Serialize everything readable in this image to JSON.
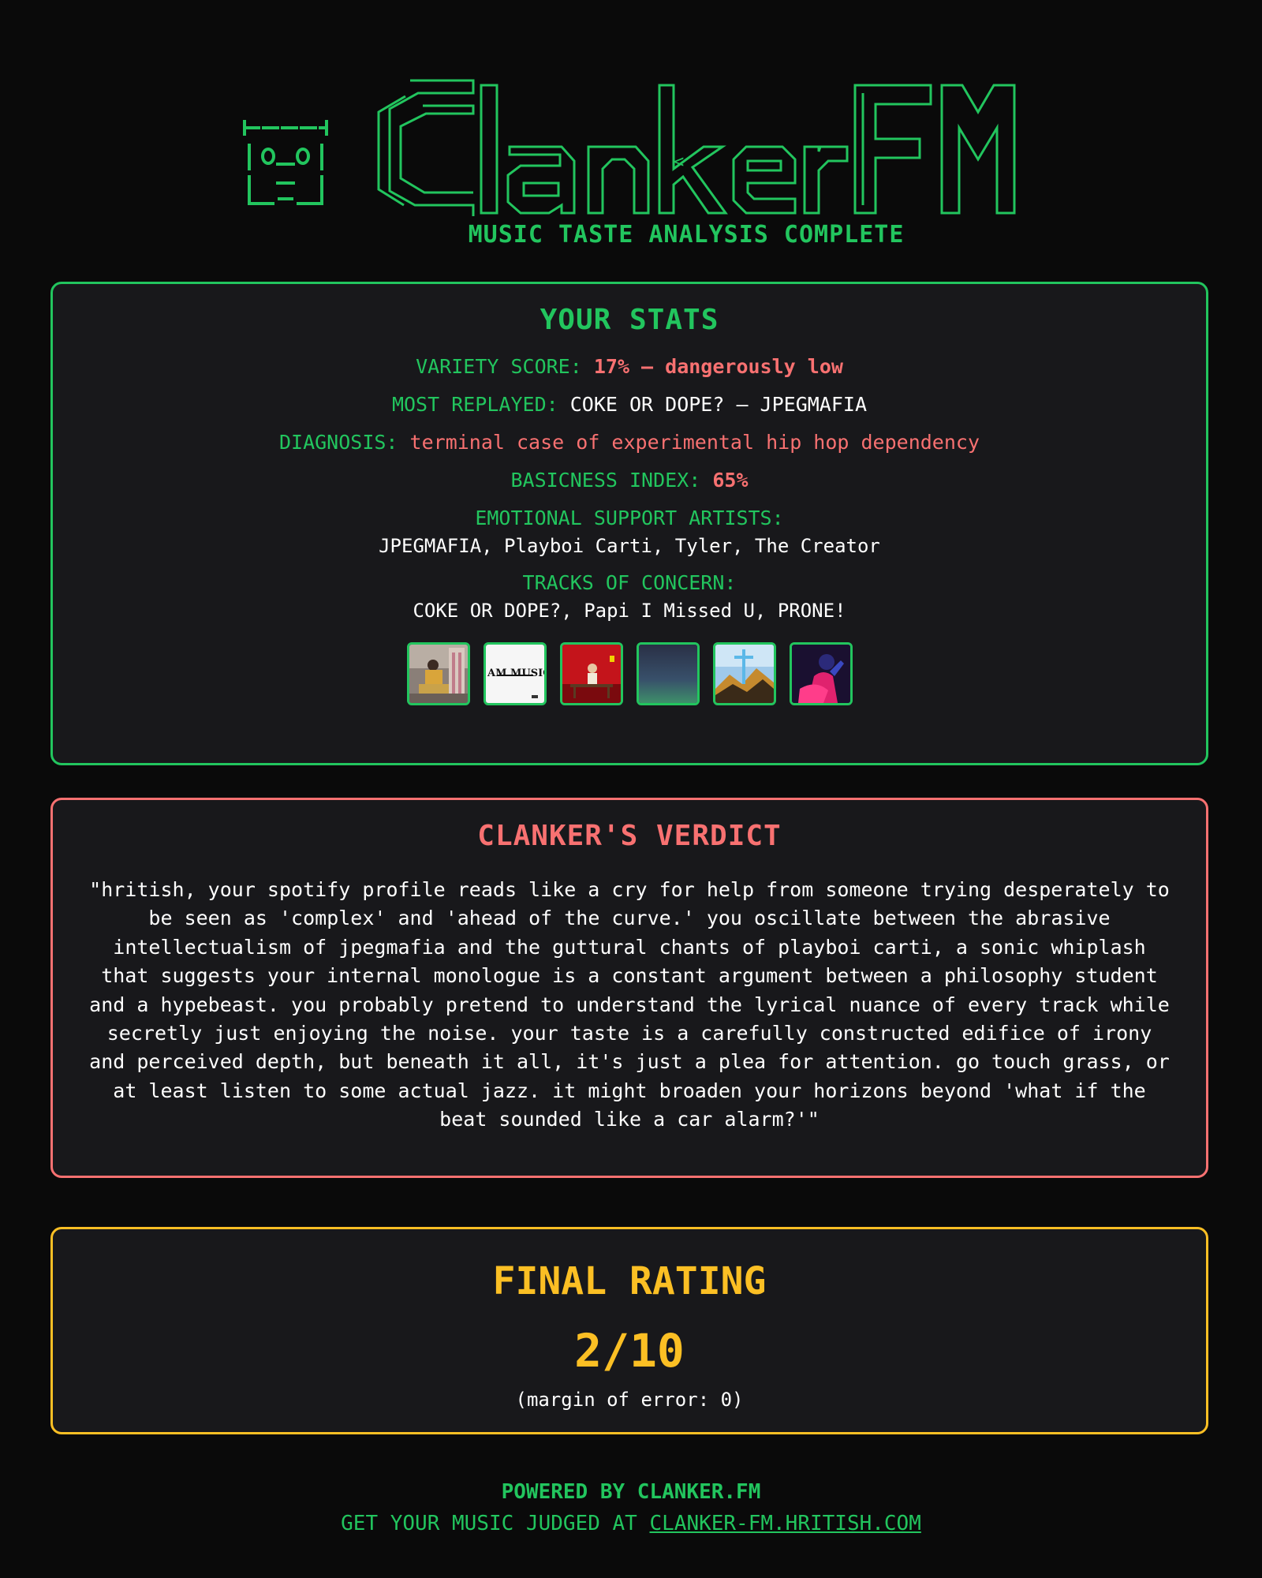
{
  "header": {
    "logo_text": "ClankerFM",
    "tagline": "MUSIC TASTE ANALYSIS COMPLETE"
  },
  "stats": {
    "title": "YOUR STATS",
    "variety_label": "VARIETY SCORE:",
    "variety_value": "17% — dangerously low",
    "most_replayed_label": "MOST REPLAYED:",
    "most_replayed_value": "COKE OR DOPE? — JPEGMAFIA",
    "diagnosis_label": "DIAGNOSIS:",
    "diagnosis_value": "terminal case of experimental hip hop dependency",
    "basicness_label": "BASICNESS INDEX:",
    "basicness_value": "65%",
    "support_artists_label": "EMOTIONAL SUPPORT ARTISTS:",
    "support_artists_value": "JPEGMAFIA, Playboi Carti, Tyler, The Creator",
    "tracks_label": "TRACKS OF CONCERN:",
    "tracks_value": "COKE OR DOPE?, Papi I Missed U, PRONE!",
    "album_covers": [
      {
        "name": "album-cover-1"
      },
      {
        "name": "album-cover-2",
        "text": "I AM MUSIC"
      },
      {
        "name": "album-cover-3"
      },
      {
        "name": "album-cover-4"
      },
      {
        "name": "album-cover-5"
      },
      {
        "name": "album-cover-6"
      }
    ]
  },
  "verdict": {
    "title": "CLANKER'S VERDICT",
    "text": "\"hritish, your spotify profile reads like a cry for help from someone trying desperately to be seen as 'complex' and 'ahead of the curve.' you oscillate between the abrasive intellectualism of jpegmafia and the guttural chants of playboi carti, a sonic whiplash that suggests your internal monologue is a constant argument between a philosophy student and a hypebeast. you probably pretend to understand the lyrical nuance of every track while secretly just enjoying the noise. your taste is a carefully constructed edifice of irony and perceived depth, but beneath it all, it's just a plea for attention. go touch grass, or at least listen to some actual jazz. it might broaden your horizons beyond 'what if the beat sounded like a car alarm?'\""
  },
  "rating": {
    "title": "FINAL RATING",
    "score": "2/10",
    "note": "(margin of error: 0)"
  },
  "footer": {
    "powered": "POWERED BY CLANKER.FM",
    "cta_prefix": "GET YOUR MUSIC JUDGED AT",
    "cta_link": "CLANKER-FM.HRITISH.COM"
  },
  "colors": {
    "background": "#0a0a0a",
    "panel": "#18181b",
    "green": "#22c55e",
    "red": "#f87171",
    "yellow": "#fbbf24"
  }
}
